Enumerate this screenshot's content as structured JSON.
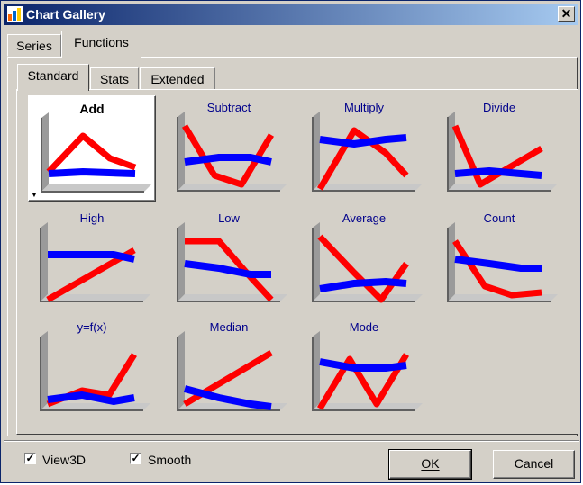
{
  "window": {
    "title": "Chart Gallery",
    "close_glyph": "✕"
  },
  "outer_tabs": [
    {
      "label": "Series"
    },
    {
      "label": "Functions"
    }
  ],
  "inner_tabs": [
    {
      "label": "Standard"
    },
    {
      "label": "Stats"
    },
    {
      "label": "Extended"
    }
  ],
  "gallery": [
    {
      "label": "Add"
    },
    {
      "label": "Subtract"
    },
    {
      "label": "Multiply"
    },
    {
      "label": "Divide"
    },
    {
      "label": "High"
    },
    {
      "label": "Low"
    },
    {
      "label": "Average"
    },
    {
      "label": "Count"
    },
    {
      "label": "y=f(x)"
    },
    {
      "label": "Median"
    },
    {
      "label": "Mode"
    }
  ],
  "selected_index": 0,
  "options": {
    "view3d": {
      "label": "View3D",
      "checked": true,
      "mark": "✓"
    },
    "smooth": {
      "label": "Smooth",
      "checked": true,
      "mark": "✓"
    }
  },
  "buttons": {
    "ok": "OK",
    "cancel": "Cancel"
  },
  "colors": {
    "red_series": "#ff0000",
    "blue_series": "#0000ff",
    "titlebar_start": "#0a246a",
    "titlebar_end": "#a6caf0",
    "label_text": "#00008b"
  }
}
